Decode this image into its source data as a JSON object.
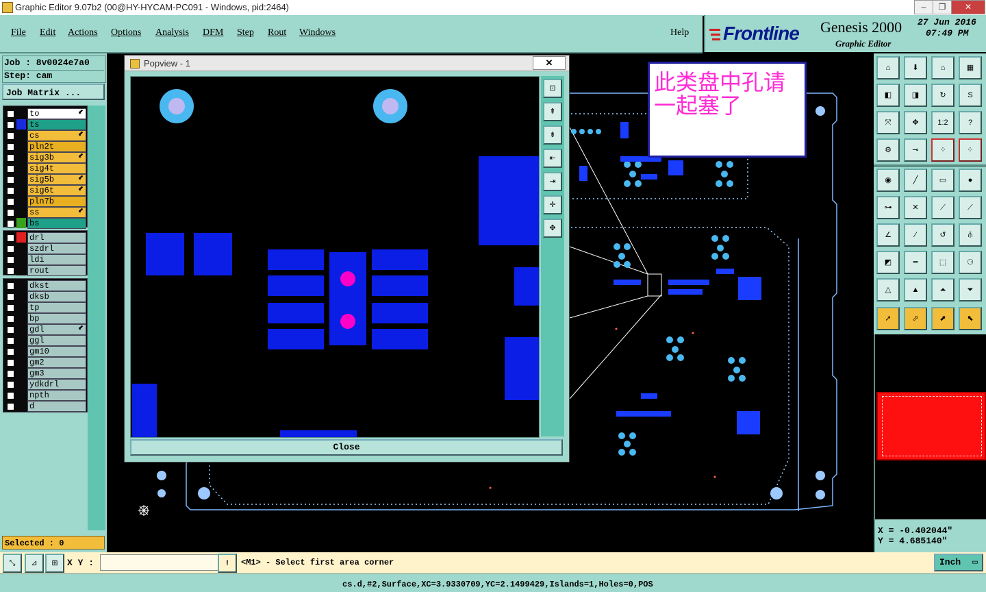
{
  "window": {
    "title": "Graphic Editor 9.07b2 (00@HY-HYCAM-PC091 - Windows, pid:2464)"
  },
  "menu": {
    "items": [
      "File",
      "Edit",
      "Actions",
      "Options",
      "Analysis",
      "DFM",
      "Step",
      "Rout",
      "Windows"
    ],
    "help": "Help"
  },
  "logo": {
    "brand": "Frontline",
    "product": "Genesis 2000",
    "subtitle": "Graphic Editor",
    "date": "27 Jun 2016",
    "time": "07:49 PM"
  },
  "job": {
    "job_label": "Job : 8v0024e7a0",
    "step_label": "Step: cam",
    "matrix_button": "Job Matrix ..."
  },
  "layers": {
    "board": [
      {
        "name": "to",
        "color": "#ffffff",
        "swatch": "#0a0a0a"
      },
      {
        "name": "ts",
        "color": "#1fa088",
        "swatch": "#1a2ce0"
      },
      {
        "name": "cs",
        "color": "#f2bd3a",
        "swatch": "#0a0a0a"
      },
      {
        "name": "pln2t",
        "color": "#e8b020",
        "swatch": "#0a0a0a"
      },
      {
        "name": "sig3b",
        "color": "#f2bd3a",
        "swatch": "#0a0a0a"
      },
      {
        "name": "sig4t",
        "color": "#f2bd3a",
        "swatch": "#0a0a0a"
      },
      {
        "name": "sig5b",
        "color": "#f2bd3a",
        "swatch": "#0a0a0a"
      },
      {
        "name": "sig6t",
        "color": "#f2bd3a",
        "swatch": "#0a0a0a"
      },
      {
        "name": "pln7b",
        "color": "#e8b020",
        "swatch": "#0a0a0a"
      },
      {
        "name": "ss",
        "color": "#f2bd3a",
        "swatch": "#0a0a0a"
      },
      {
        "name": "bs",
        "color": "#1fa088",
        "swatch": "#3aa020"
      }
    ],
    "drill": [
      {
        "name": "drl",
        "color": "#a8c8c4",
        "swatch": "#e02020"
      },
      {
        "name": "szdrl",
        "color": "#a8c8c4",
        "swatch": "#0a0a0a"
      },
      {
        "name": "ldi",
        "color": "#a8c8c4",
        "swatch": "#0a0a0a"
      },
      {
        "name": "rout",
        "color": "#a8c8c4",
        "swatch": "#0a0a0a"
      }
    ],
    "misc": [
      {
        "name": "dkst",
        "color": "#a8c8c4"
      },
      {
        "name": "dksb",
        "color": "#a8c8c4"
      },
      {
        "name": "tp",
        "color": "#a8c8c4"
      },
      {
        "name": "bp",
        "color": "#a8c8c4"
      },
      {
        "name": "gdl",
        "color": "#a8c8c4"
      },
      {
        "name": "ggl",
        "color": "#a8c8c4"
      },
      {
        "name": "gm10",
        "color": "#a8c8c4"
      },
      {
        "name": "gm2",
        "color": "#a8c8c4"
      },
      {
        "name": "gm3",
        "color": "#a8c8c4"
      },
      {
        "name": "ydkdrl",
        "color": "#a8c8c4"
      },
      {
        "name": "npth",
        "color": "#a8c8c4"
      },
      {
        "name": "d",
        "color": "#a8c8c4"
      }
    ],
    "selected": "Selected : 0"
  },
  "popup": {
    "title": "Popview - 1",
    "close": "Close",
    "close_x": "✕"
  },
  "note": {
    "line1": "此类盘中孔请",
    "line2": "一起塞了"
  },
  "toolbar": {
    "scale_label": "1:2",
    "help_label": "?"
  },
  "coords": {
    "x": "X = -0.402044\"",
    "y": "Y = 4.685140\""
  },
  "status": {
    "xy_label": "X Y :",
    "xy_value": "",
    "prompt": "<M1> - Select first area corner",
    "units": "Inch",
    "warn": "!"
  },
  "bottom": {
    "info": "cs.d,#2,Surface,XC=3.9330709,YC=2.1499429,Islands=1,Holes=0,POS"
  },
  "colors": {
    "panel": "#9fd8cc",
    "pad_blue": "#0a1ee6",
    "hole_magenta": "#ff00c8",
    "via_light": "#4ab8f0",
    "highlight_red": "#ff1010"
  }
}
